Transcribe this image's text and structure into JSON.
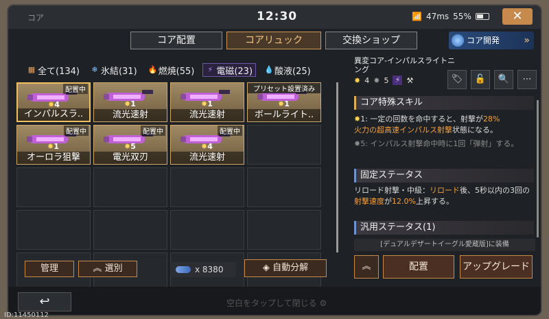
{
  "window": {
    "title": "コア"
  },
  "status": {
    "time": "12:30",
    "ping": "47ms",
    "battery": "55%",
    "battery_level": 0.55
  },
  "tabs": [
    {
      "label": "コア配置"
    },
    {
      "label": "コアリュック"
    },
    {
      "label": "交換ショップ"
    }
  ],
  "dev_button": {
    "label": "コア開発",
    "chevron": "»"
  },
  "filters": [
    {
      "icon": "grid-icon",
      "glyph": "▦",
      "label": "全て(134)",
      "color": "#e8a060"
    },
    {
      "icon": "snowflake-icon",
      "glyph": "❄",
      "label": "氷結(31)",
      "color": "#7fc4ff"
    },
    {
      "icon": "flame-icon",
      "glyph": "🔥",
      "label": "燃焼(55)",
      "color": "#f08040"
    },
    {
      "icon": "lightning-icon",
      "glyph": "⚡",
      "label": "電磁(23)",
      "color": "#b58cff"
    },
    {
      "icon": "drop-icon",
      "glyph": "💧",
      "label": "酸液(25)",
      "color": "#9ccf4a"
    }
  ],
  "items": [
    {
      "name": "インパルスラ..",
      "badge": "配置中",
      "stars": "4"
    },
    {
      "name": "流光速射",
      "badge": "",
      "stars": "1"
    },
    {
      "name": "流光速射",
      "badge": "",
      "stars": "1"
    },
    {
      "name": "ボールライト..",
      "badge": "プリセット設置済み",
      "stars": "1"
    },
    {
      "name": "オーロラ狙撃",
      "badge": "配置中",
      "stars": "1"
    },
    {
      "name": "電光双刃",
      "badge": "配置中",
      "stars": "5"
    },
    {
      "name": "流光速射",
      "badge": "配置中",
      "stars": "4"
    }
  ],
  "left_buttons": {
    "manage": "管理",
    "select": "選別",
    "auto": "自動分解"
  },
  "currency": {
    "count": "x 8380"
  },
  "detail": {
    "title": "異変コア-インパルスライトニング",
    "star_a": "4",
    "star_b": "5",
    "star_glyph": "✸",
    "element_glyph": "⚡",
    "section_skill": "コア特殊スキル",
    "skill1_prefix": "1: 一定の回数を命中すると、射撃が",
    "skill1_value": "28%",
    "skill1_hl": "火力の超高速インパルス射撃",
    "skill1_suffix": "状態になる。",
    "skill5": "5: インパルス射撃命中時に1回「弾射」する。",
    "section_fixed": "固定ステータス",
    "fixed_a": "リロード射撃・中級：",
    "fixed_hl1": "リロード",
    "fixed_b": "後、5秒以内の3回の",
    "fixed_hl2": "射撃速度",
    "fixed_c": "が",
    "fixed_hl3": "12.0%",
    "fixed_d": "上昇する。",
    "section_general": "汎用ステータス(1)",
    "equip_note": "[デュアルデザートイーグル愛蔵版]に装備",
    "btn_deploy": "配置",
    "btn_upgrade": "アップグレード",
    "btn_up": "︽"
  },
  "bottom": {
    "hint": "空白をタップして閉じる",
    "uid": "ID:11450112"
  }
}
